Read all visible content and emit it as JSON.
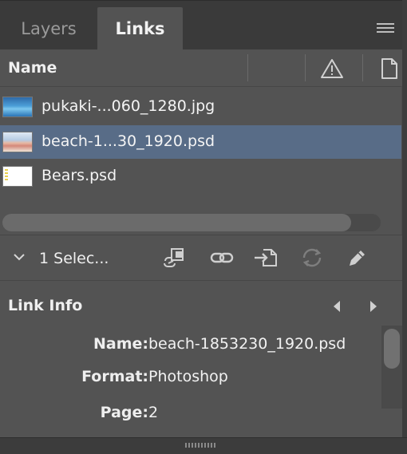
{
  "tabs": [
    {
      "label": "Layers",
      "active": false
    },
    {
      "label": "Links",
      "active": true
    }
  ],
  "icons": {
    "panel_menu": "hamburger-menu-icon",
    "status_column": "warning-triangle-icon",
    "page_column": "page-icon"
  },
  "columns": {
    "name": "Name"
  },
  "links": [
    {
      "label": "pukaki-...060_1280.jpg",
      "thumb": "lake",
      "selected": false
    },
    {
      "label": "beach-1...30_1920.psd",
      "thumb": "beach",
      "selected": true
    },
    {
      "label": "Bears.psd",
      "thumb": "bears",
      "selected": false
    }
  ],
  "toolbar": {
    "selection_label": "1 Selec...",
    "tools": [
      "relink-from-cc-libraries-icon",
      "relink-icon",
      "go-to-link-icon",
      "update-link-icon",
      "edit-original-icon"
    ]
  },
  "link_info": {
    "title": "Link Info",
    "fields": [
      {
        "key": "Name:",
        "value": "beach-1853230_1920.psd"
      },
      {
        "key": "Format:",
        "value": "Photoshop"
      },
      {
        "key": "Page:",
        "value": "2"
      }
    ]
  },
  "colors": {
    "panel_bg": "#535353",
    "tabbar_bg": "#3a3a3a",
    "selection": "#586c87"
  }
}
